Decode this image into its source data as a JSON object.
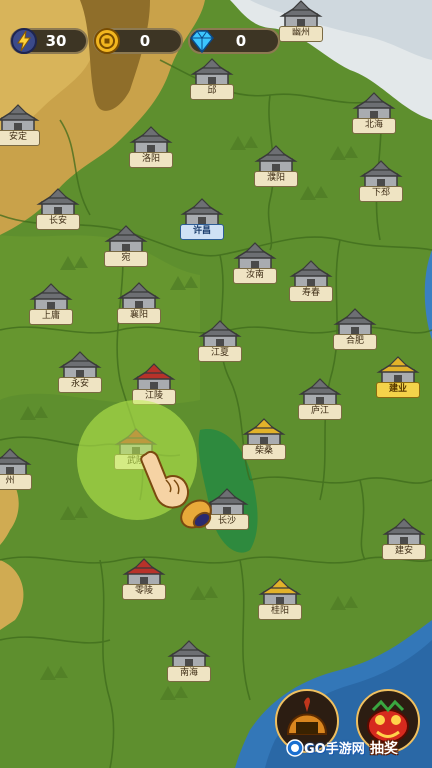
{
  "resources": {
    "energy": "30",
    "coins": "0",
    "gems": "0"
  },
  "cities": [
    {
      "id": "youzhou",
      "name": "幽州",
      "type": "gray"
    },
    {
      "id": "ji",
      "name": "邱",
      "type": "gray"
    },
    {
      "id": "anding",
      "name": "安定",
      "type": "gray"
    },
    {
      "id": "beihai",
      "name": "北海",
      "type": "gray"
    },
    {
      "id": "luoyang",
      "name": "洛阳",
      "type": "gray"
    },
    {
      "id": "puyang",
      "name": "濮阳",
      "type": "gray"
    },
    {
      "id": "xiapi",
      "name": "下邳",
      "type": "gray"
    },
    {
      "id": "changan",
      "name": "长安",
      "type": "gray"
    },
    {
      "id": "xuchang",
      "name": "许昌",
      "type": "big"
    },
    {
      "id": "wan",
      "name": "宛",
      "type": "gray"
    },
    {
      "id": "runan",
      "name": "汝南",
      "type": "gray"
    },
    {
      "id": "shouchun",
      "name": "寿春",
      "type": "gray"
    },
    {
      "id": "shangyong",
      "name": "上庸",
      "type": "gray"
    },
    {
      "id": "xiangyang",
      "name": "襄阳",
      "type": "gray"
    },
    {
      "id": "jiangxia",
      "name": "江夏",
      "type": "gray"
    },
    {
      "id": "hefei",
      "name": "合肥",
      "type": "gray"
    },
    {
      "id": "yongan",
      "name": "永安",
      "type": "gray"
    },
    {
      "id": "jiangling",
      "name": "江陵",
      "type": "red"
    },
    {
      "id": "lujiang",
      "name": "庐江",
      "type": "gray"
    },
    {
      "id": "jianye",
      "name": "建业",
      "type": "gold"
    },
    {
      "id": "wuling",
      "name": "武陵",
      "type": "red"
    },
    {
      "id": "chaisang",
      "name": "柴桑",
      "type": "yellow"
    },
    {
      "id": "yizhou",
      "name": "州",
      "type": "gray"
    },
    {
      "id": "changsha",
      "name": "长沙",
      "type": "gray"
    },
    {
      "id": "kuaiji",
      "name": "建安",
      "type": "gray"
    },
    {
      "id": "lingling",
      "name": "零陵",
      "type": "red"
    },
    {
      "id": "guiyang",
      "name": "桂阳",
      "type": "yellow"
    },
    {
      "id": "nanhai",
      "name": "南海",
      "type": "gray"
    }
  ],
  "buttons": {
    "draw": "抽奖"
  },
  "watermark": {
    "text": "GO手游网"
  }
}
